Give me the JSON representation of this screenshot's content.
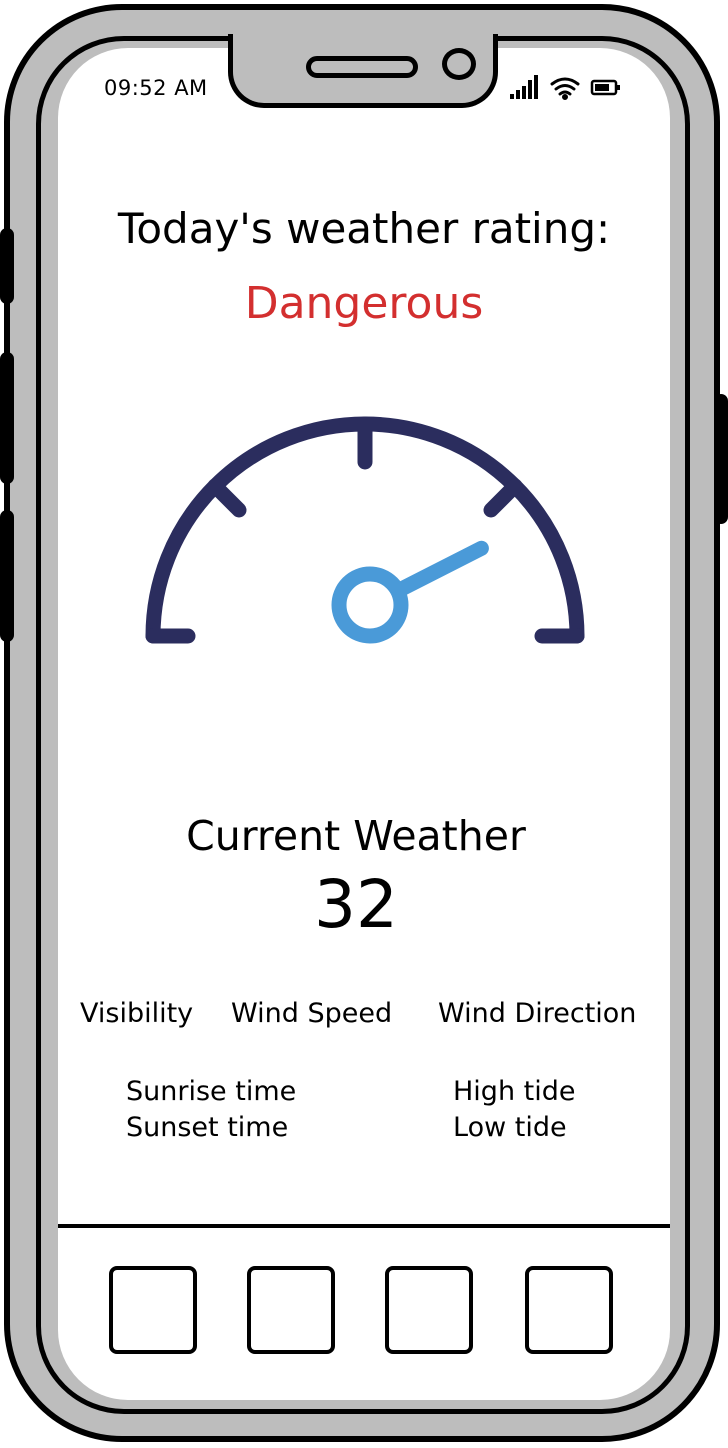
{
  "status_bar": {
    "time": "09:52 AM",
    "icons": [
      "signal-icon",
      "wifi-icon",
      "battery-icon"
    ]
  },
  "rating": {
    "heading": "Today's weather rating:",
    "value": "Dangerous",
    "value_color": "#d32f2f"
  },
  "gauge": {
    "level": 0.85,
    "arc_color": "#2b2d5e",
    "needle_color": "#4a9ad8"
  },
  "current_weather": {
    "label": "Current Weather",
    "value": "32"
  },
  "metrics": [
    "Visibility",
    "Wind Speed",
    "Wind Direction"
  ],
  "sun": {
    "sunrise": "Sunrise time",
    "sunset": "Sunset time"
  },
  "tides": {
    "high": "High tide",
    "low": "Low tide"
  },
  "nav": {
    "count": 4
  }
}
